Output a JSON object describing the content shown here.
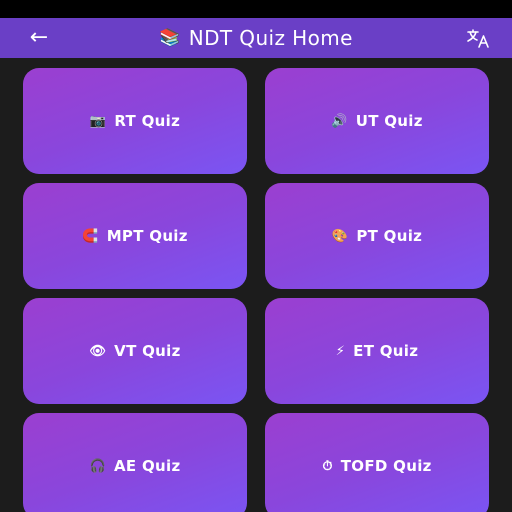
{
  "app_bar": {
    "back_glyph": "←",
    "title_icon": "📚",
    "title": "NDT Quiz Home",
    "translate_icon": "translate-icon"
  },
  "colors": {
    "app_bar": "#6a3fc6",
    "background": "#1c1c1c",
    "card_start": "#9b3fd0",
    "card_end": "#7a55f3"
  },
  "quizzes": [
    {
      "icon": "📷",
      "icon_name": "camera-icon",
      "label": "RT Quiz"
    },
    {
      "icon": "🔊",
      "icon_name": "speaker-icon",
      "label": "UT Quiz"
    },
    {
      "icon": "🧲",
      "icon_name": "magnet-icon",
      "label": "MPT Quiz"
    },
    {
      "icon": "🎨",
      "icon_name": "palette-icon",
      "label": "PT Quiz"
    },
    {
      "icon": "👁",
      "icon_name": "eye-icon",
      "label": "VT Quiz"
    },
    {
      "icon": "⚡",
      "icon_name": "lightning-icon",
      "label": "ET Quiz"
    },
    {
      "icon": "🎧",
      "icon_name": "headphones-icon",
      "label": "AE Quiz"
    },
    {
      "icon": "⏱",
      "icon_name": "stopwatch-icon",
      "label": "TOFD Quiz"
    }
  ]
}
